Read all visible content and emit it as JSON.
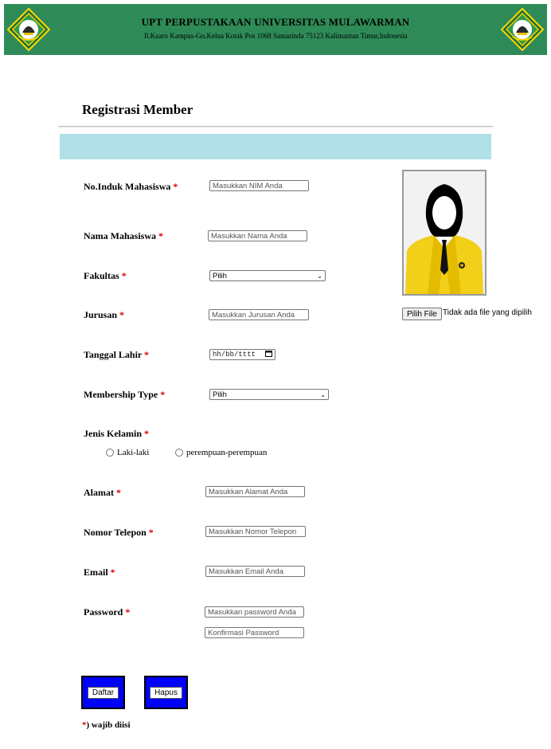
{
  "header": {
    "title": "UPT PERPUSTAKAAN UNIVERSITAS MULAWARMAN",
    "address": "Jl.Kuaro Kampus-Gn.Kelua Kotak Pos 1068 Samarinda 75123 Kalimantan Timur,Indonesia",
    "logo_icon": "university-emblem-icon",
    "bg_color": "#2e8b57"
  },
  "form": {
    "title": "Registrasi Member",
    "required_marker": "*",
    "fields": {
      "nim": {
        "label": "No.Induk Mahasiswa",
        "placeholder": "Masukkan NIM Anda"
      },
      "nama": {
        "label": "Nama Mahasiswa",
        "placeholder": "Masukkan Nama Anda"
      },
      "fakultas": {
        "label": "Fakultas",
        "value": "Pilih"
      },
      "jurusan": {
        "label": "Jurusan",
        "placeholder": "Masukkan Jurusan Anda"
      },
      "tanggal_lahir": {
        "label": "Tanggal Lahir",
        "value": "hh/bb/tttt"
      },
      "membership": {
        "label": "Membership Type",
        "value": "Pilih"
      },
      "gender": {
        "label": "Jenis Kelamin",
        "options": [
          "Laki-laki",
          "perempuan-perempuan"
        ]
      },
      "alamat": {
        "label": "Alamat",
        "placeholder": "Masukkan Alamat Anda"
      },
      "telepon": {
        "label": "Nomor Telepon",
        "placeholder": "Masukkan Nomor Telepon"
      },
      "email": {
        "label": "Email",
        "placeholder": "Masukkan Email Anda"
      },
      "password": {
        "label": "Password",
        "placeholder": "Masukkan password Anda",
        "confirm_placeholder": "Konfirmasi Password"
      }
    },
    "photo": {
      "file_button": "Pilih File",
      "file_status": "Tidak ada file yang dipilih"
    },
    "buttons": {
      "submit": "Daftar",
      "reset": "Hapus"
    },
    "required_note_star": "*",
    "required_note_text": ") wajib diisi",
    "info_bar_color": "#b0e0e6",
    "button_color": "#0000ff"
  }
}
